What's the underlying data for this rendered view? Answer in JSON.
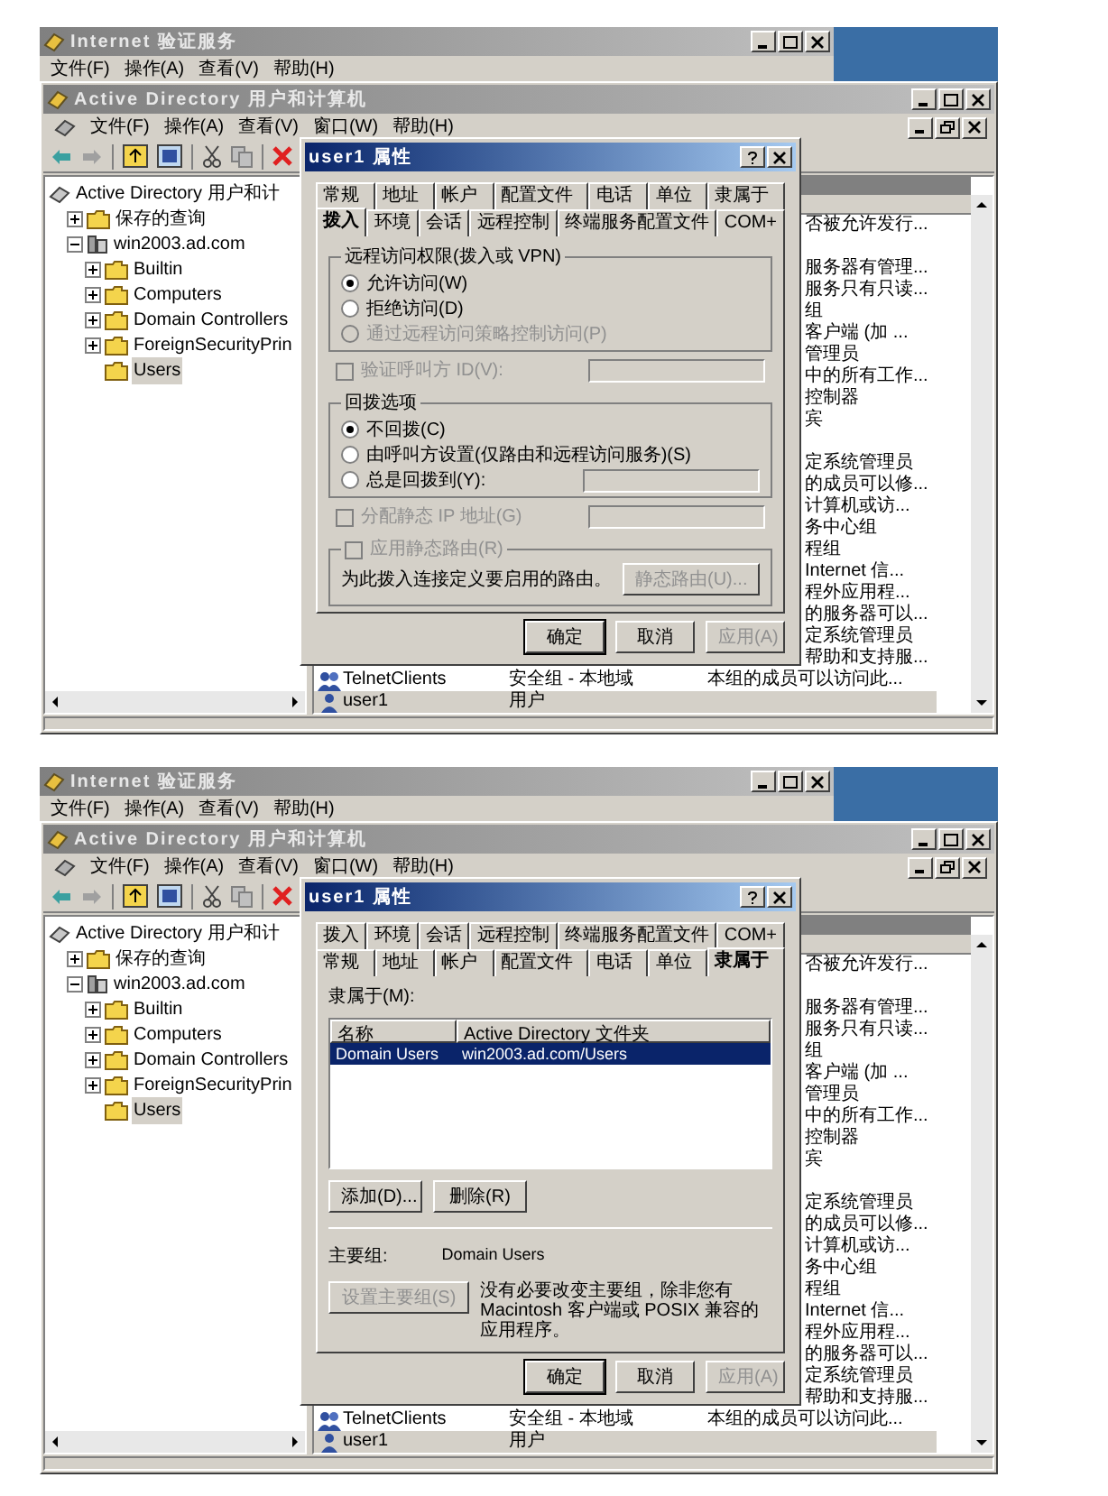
{
  "screens": [
    {
      "back_window": {
        "title": "Internet 验证服务",
        "menu": [
          "文件(F)",
          "操作(A)",
          "查看(V)",
          "帮助(H)"
        ]
      },
      "main_window": {
        "title": "Active Directory 用户和计算机",
        "menu": [
          "文件(F)",
          "操作(A)",
          "查看(V)",
          "窗口(W)",
          "帮助(H)"
        ],
        "tree": {
          "label": "Active Directory 用户和计",
          "kind": "root",
          "selected": false,
          "children": [
            {
              "label": "保存的查询",
              "kind": "folder",
              "expanded": false,
              "selected": false
            },
            {
              "label": "win2003.ad.com",
              "kind": "domain",
              "expanded": true,
              "selected": false,
              "children": [
                {
                  "label": "Builtin",
                  "kind": "folder",
                  "expanded": false,
                  "selected": false
                },
                {
                  "label": "Computers",
                  "kind": "folder",
                  "expanded": false,
                  "selected": false
                },
                {
                  "label": "Domain Controllers",
                  "kind": "folder",
                  "expanded": false,
                  "selected": false
                },
                {
                  "label": "ForeignSecurityPrin",
                  "kind": "folder",
                  "expanded": false,
                  "selected": false
                },
                {
                  "label": "Users",
                  "kind": "folder",
                  "selected": true
                }
              ]
            }
          ]
        },
        "rows": [
          {
            "kind": "covered",
            "description": "否被允许发行...",
            "selected": false
          },
          {
            "kind": "covered",
            "selected": false
          },
          {
            "kind": "covered",
            "description": "服务器有管理...",
            "selected": false
          },
          {
            "kind": "covered",
            "description": "服务只有只读...",
            "selected": false
          },
          {
            "kind": "covered",
            "description": "组",
            "selected": false
          },
          {
            "kind": "covered",
            "description": "客户端 (加 ...",
            "selected": false
          },
          {
            "kind": "covered",
            "description": "管理员",
            "selected": false
          },
          {
            "kind": "covered",
            "description": "中的所有工作...",
            "selected": false
          },
          {
            "kind": "covered",
            "description": "控制器",
            "selected": false
          },
          {
            "kind": "covered",
            "description": "宾",
            "selected": false
          },
          {
            "kind": "covered",
            "selected": false
          },
          {
            "kind": "covered",
            "description": "定系统管理员",
            "selected": false
          },
          {
            "kind": "covered",
            "description": "的成员可以修...",
            "selected": false
          },
          {
            "kind": "covered",
            "description": "计算机或访...",
            "selected": false
          },
          {
            "kind": "covered",
            "description": "务中心组",
            "selected": false
          },
          {
            "kind": "covered",
            "description": "程组",
            "selected": false
          },
          {
            "kind": "covered",
            "description": "Internet 信...",
            "selected": false
          },
          {
            "kind": "covered",
            "description": "程外应用程...",
            "selected": false
          },
          {
            "kind": "covered",
            "description": "的服务器可以...",
            "selected": false
          },
          {
            "kind": "covered",
            "description": "定系统管理员",
            "selected": false
          },
          {
            "kind": "covered",
            "description": "帮助和支持服...",
            "selected": false
          },
          {
            "kind": "group",
            "name": "TelnetClients",
            "type": "安全组 - 本地域",
            "description": "本组的成员可以访问此...",
            "selected": false
          },
          {
            "kind": "user",
            "name": "user1",
            "type": "用户",
            "selected": true
          }
        ]
      },
      "dialog": {
        "title": "user1 属性",
        "tab_rows": [
          [
            {
              "label": "常规",
              "selected": false
            },
            {
              "label": "地址",
              "selected": false
            },
            {
              "label": "帐户",
              "selected": false
            },
            {
              "label": "配置文件",
              "selected": false
            },
            {
              "label": "电话",
              "selected": false
            },
            {
              "label": "单位",
              "selected": false
            },
            {
              "label": "隶属于",
              "selected": false
            }
          ],
          [
            {
              "label": "拨入",
              "selected": true
            },
            {
              "label": "环境",
              "selected": false
            },
            {
              "label": "会话",
              "selected": false
            },
            {
              "label": "远程控制",
              "selected": false
            },
            {
              "label": "终端服务配置文件",
              "selected": false
            },
            {
              "label": "COM+",
              "selected": false
            }
          ]
        ],
        "page": {
          "kind": "dial_in",
          "items": [
            {
              "kind": "group",
              "title": "远程访问权限(拨入或 VPN)",
              "items": [
                {
                  "label": "允许访问(W)",
                  "selected": true,
                  "disabled": false
                },
                {
                  "label": "拒绝访问(D)",
                  "selected": false,
                  "disabled": false
                },
                {
                  "label": "通过远程访问策略控制访问(P)",
                  "selected": false,
                  "disabled": true
                }
              ]
            },
            {
              "kind": "checkbox",
              "label": "验证呼叫方 ID(V):",
              "checked": false,
              "disabled": true,
              "field": {
                "disabled": true
              }
            },
            {
              "kind": "group",
              "title": "回拨选项",
              "items": [
                {
                  "label": "不回拨(C)",
                  "selected": true,
                  "disabled": false
                },
                {
                  "label": "由呼叫方设置(仅路由和远程访问服务)(S)",
                  "selected": false,
                  "disabled": false
                },
                {
                  "label": "总是回拨到(Y):",
                  "selected": false,
                  "disabled": false,
                  "field": {
                    "disabled": true
                  }
                }
              ]
            },
            {
              "kind": "checkbox",
              "label": "分配静态 IP 地址(G)",
              "checked": false,
              "disabled": true,
              "field": {
                "disabled": true
              }
            },
            {
              "kind": "checkbox_group",
              "label": "应用静态路由(R)",
              "checked": false,
              "disabled": true,
              "text": "为此拨入连接定义要启用的路由。",
              "button": {
                "label": "静态路由(U)...",
                "disabled": true
              }
            }
          ]
        },
        "buttons": [
          {
            "label": "确定",
            "disabled": false,
            "default": true
          },
          {
            "label": "取消",
            "disabled": false,
            "default": false
          },
          {
            "label": "应用(A)",
            "disabled": true,
            "default": false
          }
        ]
      }
    },
    {
      "back_window": {
        "title": "Internet 验证服务",
        "menu": [
          "文件(F)",
          "操作(A)",
          "查看(V)",
          "帮助(H)"
        ]
      },
      "main_window": {
        "title": "Active Directory 用户和计算机",
        "menu": [
          "文件(F)",
          "操作(A)",
          "查看(V)",
          "窗口(W)",
          "帮助(H)"
        ],
        "tree": {
          "label": "Active Directory 用户和计",
          "kind": "root",
          "selected": false,
          "children": [
            {
              "label": "保存的查询",
              "kind": "folder",
              "expanded": false,
              "selected": false
            },
            {
              "label": "win2003.ad.com",
              "kind": "domain",
              "expanded": true,
              "selected": false,
              "children": [
                {
                  "label": "Builtin",
                  "kind": "folder",
                  "expanded": false,
                  "selected": false
                },
                {
                  "label": "Computers",
                  "kind": "folder",
                  "expanded": false,
                  "selected": false
                },
                {
                  "label": "Domain Controllers",
                  "kind": "folder",
                  "expanded": false,
                  "selected": false
                },
                {
                  "label": "ForeignSecurityPrin",
                  "kind": "folder",
                  "expanded": false,
                  "selected": false
                },
                {
                  "label": "Users",
                  "kind": "folder",
                  "selected": true
                }
              ]
            }
          ]
        },
        "rows": [
          {
            "kind": "covered",
            "description": "否被允许发行...",
            "selected": false
          },
          {
            "kind": "covered",
            "selected": false
          },
          {
            "kind": "covered",
            "description": "服务器有管理...",
            "selected": false
          },
          {
            "kind": "covered",
            "description": "服务只有只读...",
            "selected": false
          },
          {
            "kind": "covered",
            "description": "组",
            "selected": false
          },
          {
            "kind": "covered",
            "description": "客户端 (加 ...",
            "selected": false
          },
          {
            "kind": "covered",
            "description": "管理员",
            "selected": false
          },
          {
            "kind": "covered",
            "description": "中的所有工作...",
            "selected": false
          },
          {
            "kind": "covered",
            "description": "控制器",
            "selected": false
          },
          {
            "kind": "covered",
            "description": "宾",
            "selected": false
          },
          {
            "kind": "covered",
            "selected": false
          },
          {
            "kind": "covered",
            "description": "定系统管理员",
            "selected": false
          },
          {
            "kind": "covered",
            "description": "的成员可以修...",
            "selected": false
          },
          {
            "kind": "covered",
            "description": "计算机或访...",
            "selected": false
          },
          {
            "kind": "covered",
            "description": "务中心组",
            "selected": false
          },
          {
            "kind": "covered",
            "description": "程组",
            "selected": false
          },
          {
            "kind": "covered",
            "description": "Internet 信...",
            "selected": false
          },
          {
            "kind": "covered",
            "description": "程外应用程...",
            "selected": false
          },
          {
            "kind": "covered",
            "description": "的服务器可以...",
            "selected": false
          },
          {
            "kind": "covered",
            "description": "定系统管理员",
            "selected": false
          },
          {
            "kind": "covered",
            "description": "帮助和支持服...",
            "selected": false
          },
          {
            "kind": "group",
            "name": "TelnetClients",
            "type": "安全组 - 本地域",
            "description": "本组的成员可以访问此...",
            "selected": false
          },
          {
            "kind": "user",
            "name": "user1",
            "type": "用户",
            "selected": true
          }
        ]
      },
      "dialog": {
        "title": "user1 属性",
        "tab_rows": [
          [
            {
              "label": "拨入",
              "selected": false
            },
            {
              "label": "环境",
              "selected": false
            },
            {
              "label": "会话",
              "selected": false
            },
            {
              "label": "远程控制",
              "selected": false
            },
            {
              "label": "终端服务配置文件",
              "selected": false
            },
            {
              "label": "COM+",
              "selected": false
            }
          ],
          [
            {
              "label": "常规",
              "selected": false
            },
            {
              "label": "地址",
              "selected": false
            },
            {
              "label": "帐户",
              "selected": false
            },
            {
              "label": "配置文件",
              "selected": false
            },
            {
              "label": "电话",
              "selected": false
            },
            {
              "label": "单位",
              "selected": false
            },
            {
              "label": "隶属于",
              "selected": true
            }
          ]
        ],
        "page": {
          "kind": "member_of",
          "list_label": "隶属于(M):",
          "columns": [
            "名称",
            "Active Directory 文件夹"
          ],
          "rows": [
            {
              "cells": [
                "Domain Users",
                "win2003.ad.com/Users"
              ],
              "selected": true
            }
          ],
          "buttons": [
            {
              "label": "添加(D)...",
              "disabled": false
            },
            {
              "label": "删除(R)",
              "disabled": false
            }
          ],
          "primary_group_label": "主要组:",
          "primary_group": "Domain Users",
          "set_button": {
            "label": "设置主要组(S)",
            "disabled": true
          },
          "note": "没有必要改变主要组，除非您有 Macintosh 客户端或 POSIX 兼容的应用程序。"
        },
        "buttons": [
          {
            "label": "确定",
            "disabled": false,
            "default": true
          },
          {
            "label": "取消",
            "disabled": false,
            "default": false
          },
          {
            "label": "应用(A)",
            "disabled": true,
            "default": false
          }
        ]
      }
    }
  ]
}
